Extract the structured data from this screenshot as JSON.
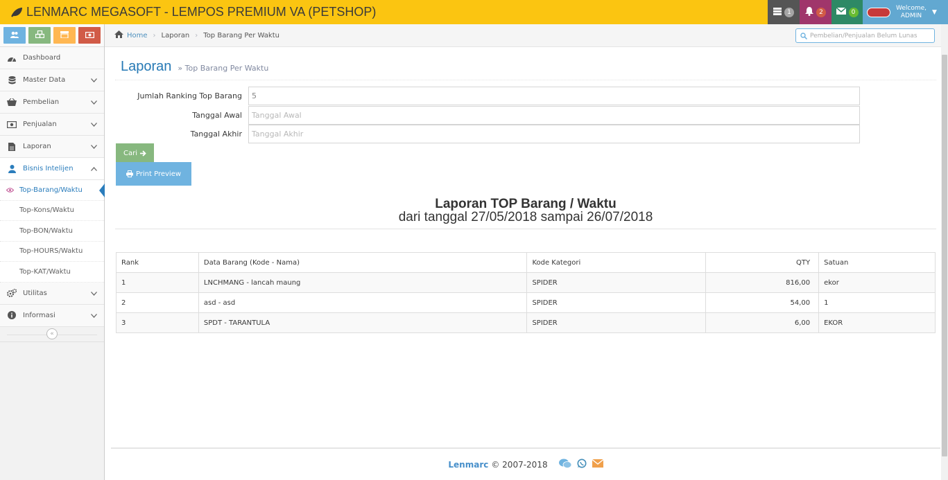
{
  "navbar": {
    "title": "LENMARC MEGASOFT - LEMPOS PREMIUM VA (PETSHOP)",
    "tasks_count": "1",
    "notifications_count": "2",
    "messages_count": "0",
    "welcome": "Welcome,",
    "user": "ADMIN"
  },
  "sidebar": {
    "shortcut_icons": [
      "users-icon",
      "cubes-icon",
      "shop-icon",
      "money-icon"
    ],
    "items": [
      {
        "label": "Dashboard",
        "icon": "tachometer-icon"
      },
      {
        "label": "Master Data",
        "icon": "database-icon"
      },
      {
        "label": "Pembelian",
        "icon": "basket-icon"
      },
      {
        "label": "Penjualan",
        "icon": "money-icon"
      },
      {
        "label": "Laporan",
        "icon": "file-icon"
      },
      {
        "label": "Bisnis Intelijen",
        "icon": "user-icon"
      }
    ],
    "subitems": [
      "Top-Barang/Waktu",
      "Top-Kons/Waktu",
      "Top-BON/Waktu",
      "Top-HOURS/Waktu",
      "Top-KAT/Waktu"
    ],
    "items_after": [
      {
        "label": "Utilitas",
        "icon": "cogs-icon"
      },
      {
        "label": "Informasi",
        "icon": "info-icon"
      }
    ]
  },
  "breadcrumb": {
    "home": "Home",
    "level1": "Laporan",
    "level2": "Top Barang Per Waktu",
    "search_placeholder": "Pembelian/Penjualan Belum Lunas"
  },
  "page": {
    "title": "Laporan",
    "subtitle": "Top Barang Per Waktu"
  },
  "form": {
    "ranking_label": "Jumlah Ranking Top Barang",
    "ranking_value": "5",
    "start_label": "Tanggal Awal",
    "start_placeholder": "Tanggal Awal",
    "end_label": "Tanggal Akhir",
    "end_placeholder": "Tanggal Akhir",
    "search_button": "Cari",
    "print_button": "Print Preview"
  },
  "report": {
    "title": "Laporan TOP Barang / Waktu",
    "subtitle": "dari tanggal 27/05/2018 sampai 26/07/2018",
    "columns": [
      "Rank",
      "Data Barang (Kode - Nama)",
      "Kode Kategori",
      "QTY",
      "Satuan"
    ],
    "rows": [
      [
        "1",
        "LNCHMANG - lancah maung",
        "SPIDER",
        "816,00",
        "ekor"
      ],
      [
        "2",
        "asd - asd",
        "SPIDER",
        "54,00",
        "1"
      ],
      [
        "3",
        "SPDT - TARANTULA",
        "SPIDER",
        "6,00",
        "EKOR"
      ]
    ]
  },
  "footer": {
    "brand": "Lenmarc",
    "copyright": "© 2007-2018"
  },
  "colors": {
    "navbar": "#fbc511",
    "link": "#2b7dbc",
    "btn_green": "#87b87f",
    "btn_blue": "#6fb3e0"
  }
}
